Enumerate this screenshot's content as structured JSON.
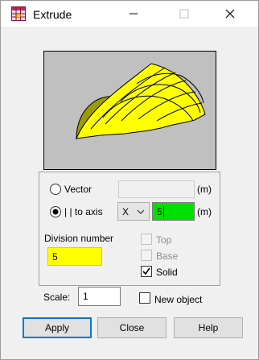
{
  "window": {
    "title": "Extrude"
  },
  "direction": {
    "vector_label": "Vector",
    "vector_value": "",
    "vector_unit": "(m)",
    "axis_label": "| | to axis",
    "axis_selected": "X",
    "axis_value": "5",
    "axis_unit": "(m)",
    "selected_mode": "axis"
  },
  "division": {
    "label": "Division number",
    "value": "5"
  },
  "options": {
    "top_label": "Top",
    "top_checked": false,
    "base_label": "Base",
    "base_checked": false,
    "solid_label": "Solid",
    "solid_checked": true
  },
  "scale": {
    "label": "Scale:",
    "value": "1"
  },
  "new_object": {
    "label": "New object",
    "checked": false
  },
  "buttons": {
    "apply": "Apply",
    "close": "Close",
    "help": "Help"
  },
  "colors": {
    "highlight": "#ffff00",
    "axis_value_bg": "#00e000",
    "preview_bg": "#c0c0c0",
    "accent": "#0078d7"
  }
}
